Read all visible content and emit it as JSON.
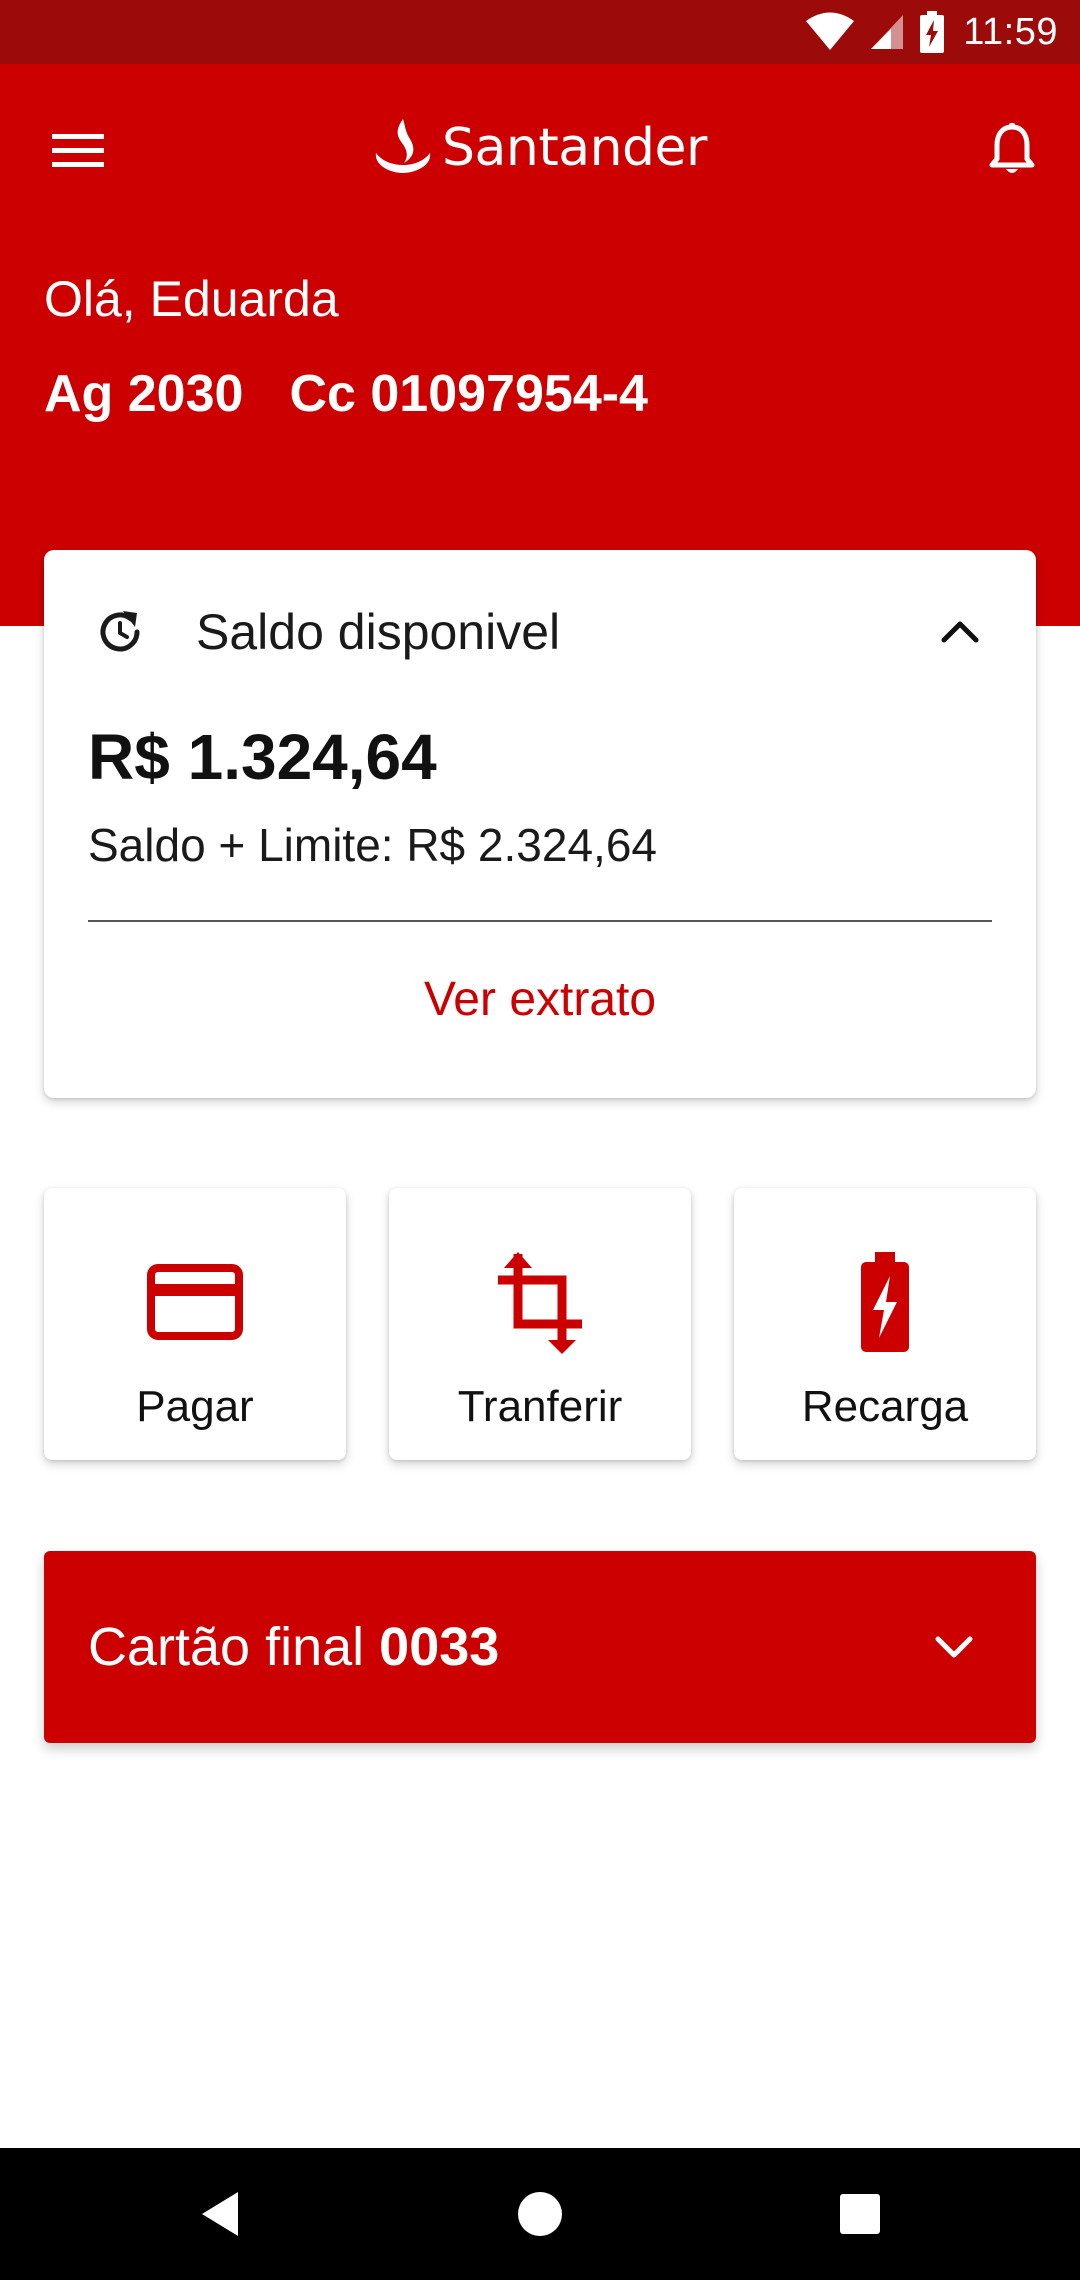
{
  "status_bar": {
    "time": "11:59",
    "icons": [
      "wifi-icon",
      "cellular-signal-icon",
      "battery-charging-icon"
    ]
  },
  "header": {
    "brand_name": "Santander",
    "greeting": "Olá, Eduarda",
    "agency": "Ag 2030",
    "account": "Cc 01097954-4",
    "icons": [
      "menu-icon",
      "santander-flame-logo",
      "notification-bell-icon"
    ]
  },
  "balance_card": {
    "title": "Saldo disponivel",
    "balance": "R$ 1.324,64",
    "limit_line": "Saldo + Limite: R$ 2.324,64",
    "statement_link": "Ver extrato",
    "icons": [
      "refresh-icon",
      "chevron-up-icon"
    ]
  },
  "actions": [
    {
      "label": "Pagar",
      "icon": "credit-card-icon"
    },
    {
      "label": "Tranferir",
      "icon": "transfer-arrows-icon"
    },
    {
      "label": "Recarga",
      "icon": "battery-recharge-icon"
    }
  ],
  "card_selector": {
    "prefix": "Cartão final",
    "number": "0033",
    "icon": "chevron-down-icon"
  },
  "nav_bar": {
    "icons": [
      "back-icon",
      "home-icon",
      "recents-icon"
    ]
  },
  "colors": {
    "brand_red": "#cc0000",
    "status_bar": "#9c0a0a",
    "background": "#ffffff",
    "nav_bar": "#000000"
  }
}
